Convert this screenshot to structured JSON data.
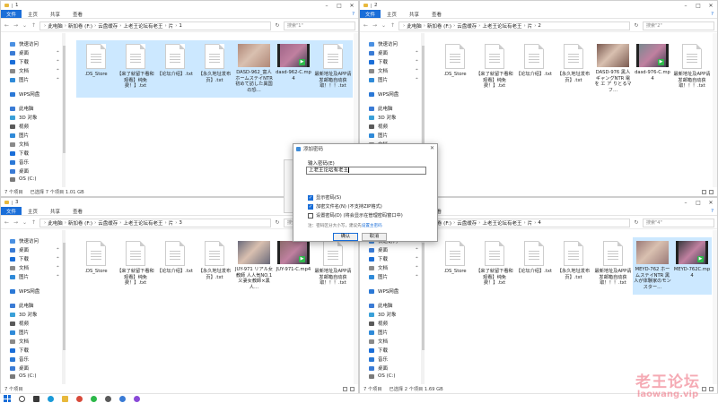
{
  "colors": {
    "accent": "#1a6ed8",
    "selection": "#cce8ff",
    "folder": "#e8b93d",
    "video_badge": "#2db84a",
    "watermark": "#ee6677"
  },
  "ribbon": {
    "file": "文件",
    "home": "主页",
    "share": "共享",
    "view": "查看"
  },
  "sidebar": {
    "items": [
      {
        "label": "快速访问",
        "icon": "star-icon",
        "color": "#4a90e2"
      },
      {
        "label": "桌面",
        "icon": "desktop-icon",
        "color": "#3a7bd5"
      },
      {
        "label": "下载",
        "icon": "download-icon",
        "color": "#1a6ed8"
      },
      {
        "label": "文档",
        "icon": "document-icon",
        "color": "#8a8a8a"
      },
      {
        "label": "图片",
        "icon": "picture-icon",
        "color": "#2f8ad8"
      },
      {
        "label": "WPS网盘",
        "icon": "cloud-icon",
        "color": "#2a78d6"
      },
      {
        "label": "此电脑",
        "icon": "computer-icon",
        "color": "#3a7bd5"
      },
      {
        "label": "3D 对象",
        "icon": "cube-icon",
        "color": "#3aa0d8"
      },
      {
        "label": "视频",
        "icon": "video-icon",
        "color": "#5a5a5a"
      },
      {
        "label": "图片",
        "icon": "picture-icon",
        "color": "#2f8ad8"
      },
      {
        "label": "文档",
        "icon": "document-icon",
        "color": "#8a8a8a"
      },
      {
        "label": "下载",
        "icon": "download-icon",
        "color": "#1a6ed8"
      },
      {
        "label": "音乐",
        "icon": "music-icon",
        "color": "#2a78d6"
      },
      {
        "label": "桌面",
        "icon": "desktop-icon",
        "color": "#3a7bd5"
      },
      {
        "label": "OS (C:)",
        "icon": "drive-icon",
        "color": "#7a7a7a"
      }
    ]
  },
  "windows": [
    {
      "title": "1",
      "path": [
        "此电脑",
        "新加卷 (F:)",
        "云盘缓存",
        "上老王论坛有老王",
        "片",
        "1"
      ],
      "search": "搜索\"1\"",
      "status": [
        "7 个项目",
        "已选择 7 个项目 1.01 GB"
      ],
      "files": [
        {
          "name": ".DS_Store",
          "type": "doc",
          "selected": true
        },
        {
          "name": "【来了就留下看和观看】纯免费！】.txt",
          "type": "doc",
          "selected": true
        },
        {
          "name": "【论坛介绍】.txt",
          "type": "doc",
          "selected": true
        },
        {
          "name": "【永久地址发布页】.txt",
          "type": "doc",
          "selected": true
        },
        {
          "name": "DASD-962_富人ホームステイNTR 初めて訪した異国の恐…",
          "type": "thumb",
          "selected": true,
          "tint": "#b08878"
        },
        {
          "name": "dasd-962-C.mp4",
          "type": "video",
          "selected": true,
          "tint": "#a06688"
        },
        {
          "name": "最新地址及APP请发邮箱自动获取！！！.txt",
          "type": "doc",
          "selected": true
        }
      ]
    },
    {
      "title": "2",
      "path": [
        "此电脑",
        "新加卷 (F:)",
        "云盘缓存",
        "上老王论坛有老王",
        "片",
        "2"
      ],
      "search": "搜索\"2\"",
      "status": [
        "7 个项目"
      ],
      "files": [
        {
          "name": ".DS_Store",
          "type": "doc"
        },
        {
          "name": "【来了就留下看和观看】纯免费！】.txt",
          "type": "doc"
        },
        {
          "name": "【论坛介绍】.txt",
          "type": "doc"
        },
        {
          "name": "【永久地址发布页】.txt",
          "type": "doc"
        },
        {
          "name": "DASD-976 黑人ギャングNTR 電を エ ア りとるマフ…",
          "type": "thumb",
          "tint": "#7a5a50"
        },
        {
          "name": "dasd-976-C.mp4",
          "type": "video",
          "tint": "#7a8a90"
        },
        {
          "name": "最新地址及APP请发邮箱自动获取！！！.txt",
          "type": "doc"
        }
      ]
    },
    {
      "title": "3",
      "path": [
        "此电脑",
        "新加卷 (F:)",
        "云盘缓存",
        "上老王论坛有老王",
        "片",
        "3"
      ],
      "search": "搜索\"3\"",
      "status": [
        "7 个项目"
      ],
      "files": [
        {
          "name": ".DS_Store",
          "type": "doc"
        },
        {
          "name": "【来了就留下看和观看】纯免费！】.txt",
          "type": "doc"
        },
        {
          "name": "【论坛介绍】.txt",
          "type": "doc"
        },
        {
          "name": "【永久地址发布页】.txt",
          "type": "doc"
        },
        {
          "name": "JUY-971 リアル女教師 人人気NO.1 义妻女教師×黑人…",
          "type": "thumb",
          "tint": "#6a6a7a"
        },
        {
          "name": "JUY-971-C.mp4",
          "type": "video",
          "tint": "#8a6a6a"
        },
        {
          "name": "最新地址及APP请发邮箱自动获取！！！.txt",
          "type": "doc"
        }
      ]
    },
    {
      "title": "4",
      "path": [
        "此电脑",
        "新加卷 (F:)",
        "云盘缓存",
        "上老王论坛有老王",
        "片",
        "4"
      ],
      "search": "搜索\"4\"",
      "status": [
        "7 个项目",
        "已选择 2 个项目 1.69 GB"
      ],
      "files": [
        {
          "name": ".DS_Store",
          "type": "doc"
        },
        {
          "name": "【来了就留下看和观看】纯免费！】.txt",
          "type": "doc"
        },
        {
          "name": "【论坛介绍】.txt",
          "type": "doc"
        },
        {
          "name": "【永久地址发布页】.txt",
          "type": "doc"
        },
        {
          "name": "最新地址及APP请发邮箱自动获取！！！.txt",
          "type": "doc"
        },
        {
          "name": "MEYD-762 ホームステイNTR 黑人が体験家のモンスター…",
          "type": "thumb",
          "selected": true,
          "tint": "#9a7a78"
        },
        {
          "name": "MEYD-762C.mp4",
          "type": "video",
          "selected": true,
          "tint": "#3a3a40"
        }
      ]
    }
  ],
  "dialog": {
    "title": "添加密码",
    "label": "输入密码(E)",
    "value": "上老王论坛有老王",
    "options": [
      {
        "label": "显示密码(S)",
        "checked": true
      },
      {
        "label": "加密文件名(N) (不支持ZIP格式)",
        "checked": true
      },
      {
        "label": "设置密码(D) (将会显示在管理密码窗口中)",
        "checked": false
      }
    ],
    "hint": "注：密码区分大小写，建议先",
    "hint_link": "设置主密码",
    "ok": "确认",
    "cancel": "取消"
  },
  "watermark": {
    "line1": "老王论坛",
    "line2": "laowang.vip"
  }
}
